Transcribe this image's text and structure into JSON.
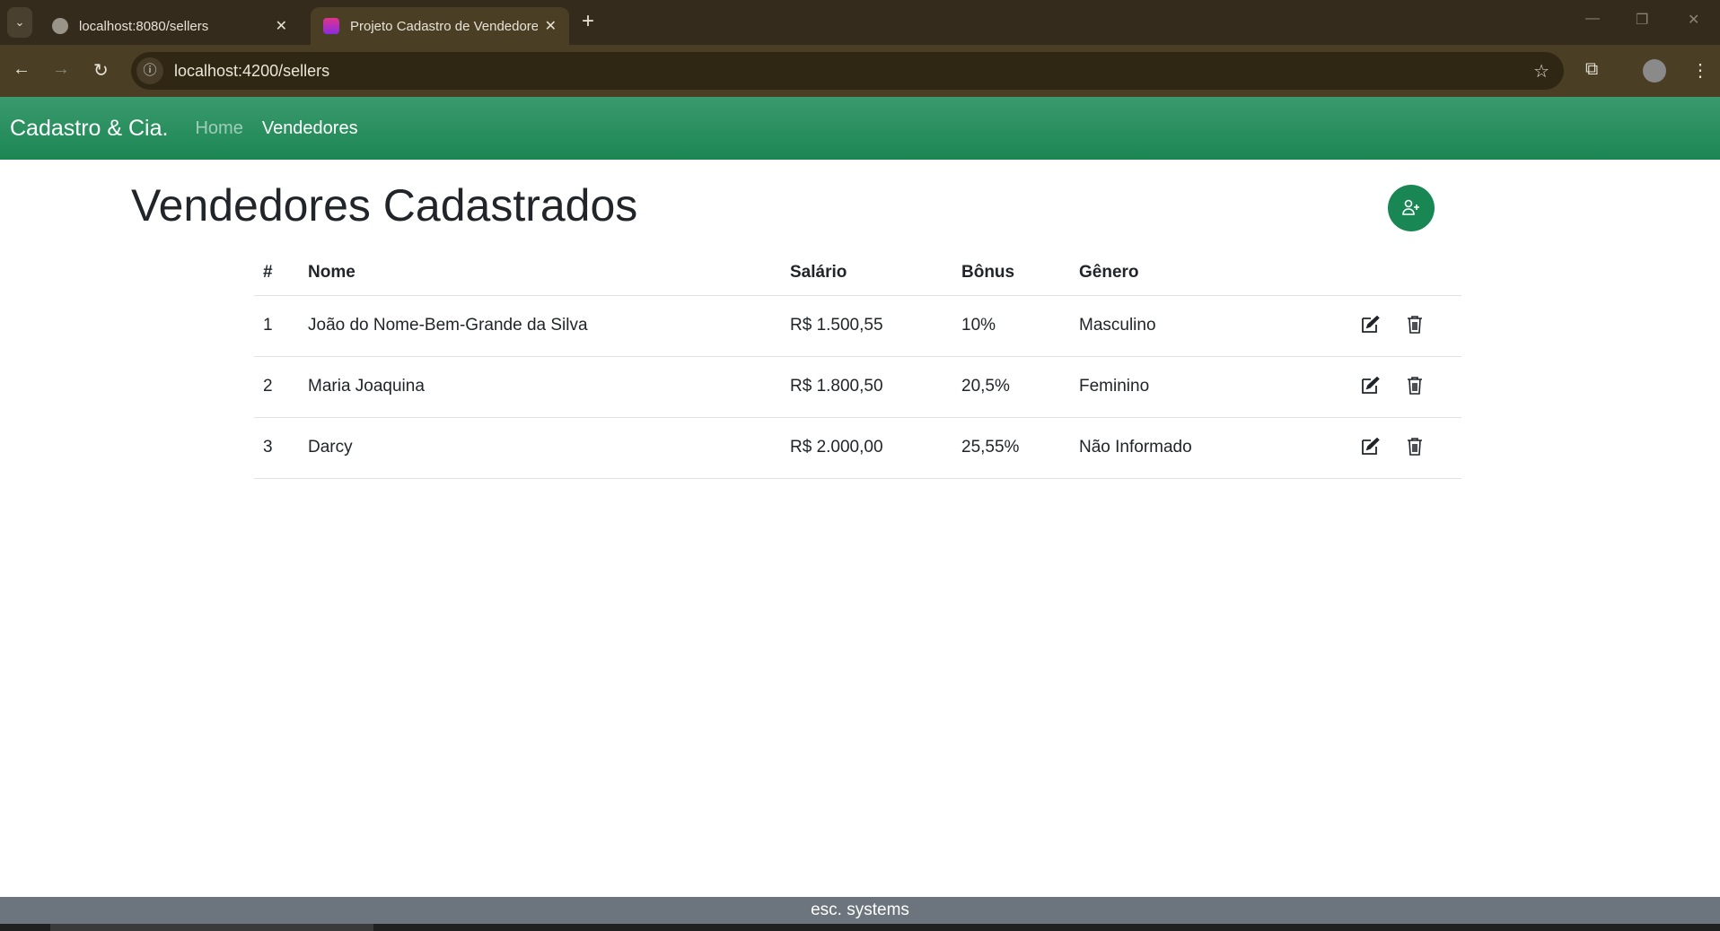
{
  "browser": {
    "tabs": [
      {
        "title": "localhost:8080/sellers",
        "active": false
      },
      {
        "title": "Projeto Cadastro de Vendedores",
        "active": true
      }
    ],
    "url": "localhost:4200/sellers"
  },
  "navbar": {
    "brand": "Cadastro & Cia.",
    "links": [
      {
        "label": "Home",
        "active": false
      },
      {
        "label": "Vendedores",
        "active": true
      }
    ]
  },
  "page": {
    "title": "Vendedores Cadastrados",
    "add_icon": "person-plus-icon"
  },
  "table": {
    "headers": [
      "#",
      "Nome",
      "Salário",
      "Bônus",
      "Gênero"
    ],
    "rows": [
      {
        "id": "1",
        "nome": "João do Nome-Bem-Grande da Silva",
        "salario": "R$ 1.500,55",
        "bonus": "10%",
        "genero": "Masculino"
      },
      {
        "id": "2",
        "nome": "Maria Joaquina",
        "salario": "R$ 1.800,50",
        "bonus": "20,5%",
        "genero": "Feminino"
      },
      {
        "id": "3",
        "nome": "Darcy",
        "salario": "R$ 2.000,00",
        "bonus": "25,55%",
        "genero": "Não Informado"
      }
    ]
  },
  "footer": {
    "text": "esc. systems"
  },
  "colors": {
    "primary": "#198754",
    "footer": "#6c757d"
  }
}
